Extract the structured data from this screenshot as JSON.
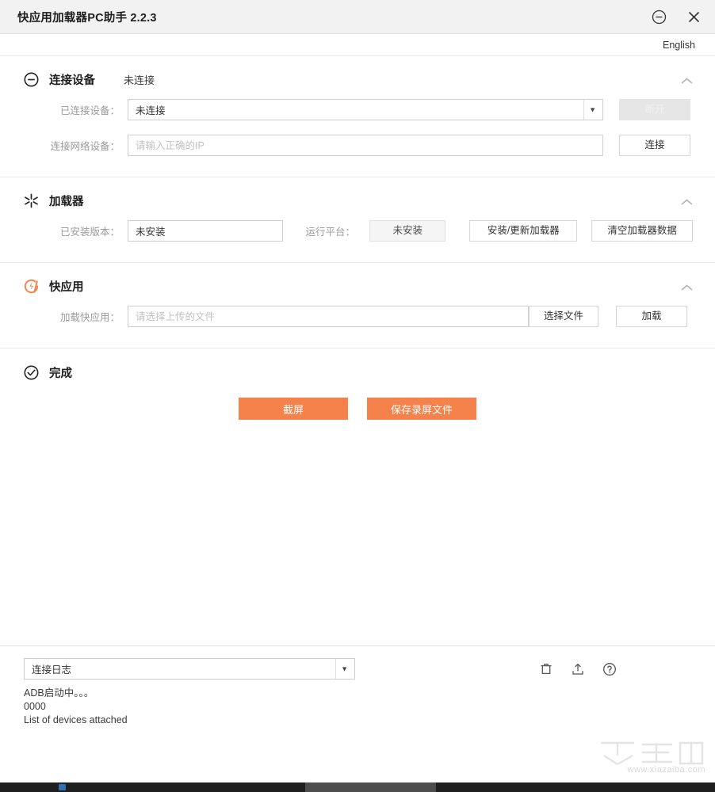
{
  "window": {
    "title": "快应用加载器PC助手 2.2.3",
    "minimize_icon": "minimize-circle-icon",
    "close_icon": "close-icon"
  },
  "language": {
    "label": "English"
  },
  "sections": {
    "device": {
      "icon": "link-circle-icon",
      "title": "连接设备",
      "status": "未连接",
      "collapse_icon": "chevron-up-icon",
      "connected_device": {
        "label": "已连接设备：",
        "value": "未连接",
        "caret": "▼"
      },
      "disconnect_button": "断开",
      "network_device": {
        "label": "连接网络设备：",
        "value": "",
        "placeholder": "请输入正确的IP"
      },
      "connect_button": "连接"
    },
    "loader": {
      "icon": "starburst-icon",
      "title": "加载器",
      "collapse_icon": "chevron-up-icon",
      "installed_version": {
        "label": "已安装版本：",
        "value": "未安装"
      },
      "platform": {
        "label": "运行平台：",
        "value": "未安装"
      },
      "install_button": "安装/更新加载器",
      "clear_button": "清空加载器数据"
    },
    "quickapp": {
      "icon": "quickapp-bolt-icon",
      "title": "快应用",
      "collapse_icon": "chevron-up-icon",
      "load_file": {
        "label": "加载快应用：",
        "value": "",
        "placeholder": "请选择上传的文件"
      },
      "choose_file_button": "选择文件",
      "load_button": "加载"
    },
    "complete": {
      "icon": "check-circle-icon",
      "title": "完成",
      "screenshot_button": "截屏",
      "save_recording_button": "保存录屏文件"
    }
  },
  "log": {
    "selected": "连接日志",
    "caret": "▼",
    "icons": {
      "clear": "trash-icon",
      "export": "upload-icon",
      "help": "help-circle-icon"
    },
    "lines": [
      "ADB启动中。。。",
      "0000",
      "List of devices attached"
    ]
  },
  "watermark": {
    "brand": "下载吧",
    "url": "www.xiazaiba.com"
  },
  "colors": {
    "accent_orange": "#f5824b",
    "titlebar_bg": "#f2f2f2",
    "label_gray": "#9a9a9a",
    "border": "#cfcfcf"
  }
}
